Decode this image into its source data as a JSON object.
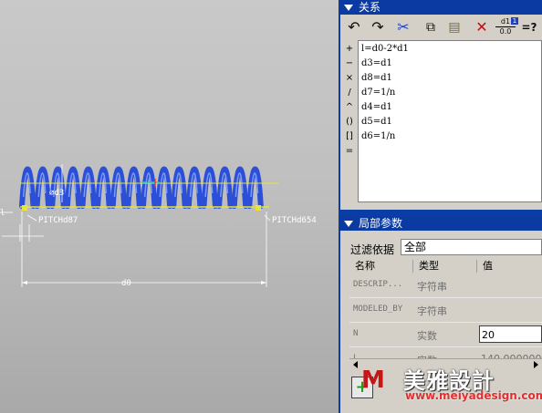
{
  "relations": {
    "header_title": "关系",
    "toolbar": [
      {
        "icon": "undo-icon",
        "glyph": "↶"
      },
      {
        "icon": "redo-icon",
        "glyph": "↷"
      },
      {
        "icon": "cut-icon",
        "glyph": "✂"
      },
      {
        "icon": "copy-icon",
        "glyph": "⧉"
      },
      {
        "icon": "paste-icon",
        "glyph": "📋"
      },
      {
        "icon": "delete-icon",
        "glyph": "✕"
      },
      {
        "icon": "units-icon",
        "top": "d1",
        "bottom": "0.0",
        "badge": "1"
      },
      {
        "icon": "verify-icon",
        "glyph": "=?"
      }
    ],
    "operators": [
      "+",
      "−",
      "×",
      "/",
      "^",
      "()",
      "[]",
      "="
    ],
    "equations": [
      "l=d0-2*d1",
      "d3=d1",
      "d8=d1",
      "d7=1/n",
      "d4=d1",
      "d5=d1",
      "d6=1/n"
    ]
  },
  "local_params": {
    "header_title": "局部参数",
    "filter_label": "过滤依据",
    "filter_value": "全部",
    "columns": [
      "名称",
      "类型",
      "值"
    ],
    "rows": [
      {
        "name": "DESCRIP...",
        "type": "字符串",
        "value": ""
      },
      {
        "name": "MODELED_BY",
        "type": "字符串",
        "value": ""
      },
      {
        "name": "N",
        "type": "实数",
        "value": "20"
      },
      {
        "name": "L",
        "type": "实数",
        "value": "140.000000"
      }
    ]
  },
  "viewport": {
    "labels": {
      "pitch_left": "PITCHd87",
      "pitch_right": "PITCHd654",
      "d0": "d0",
      "dia": "⌀d3"
    }
  },
  "watermark": {
    "brand": "美雅設計",
    "url": "www.meiyadesign.com"
  },
  "colors": {
    "panel_blue": "#0a3ea6",
    "spring_blue": "#2b4fd6",
    "axis_yellow": "#e8e43a"
  }
}
